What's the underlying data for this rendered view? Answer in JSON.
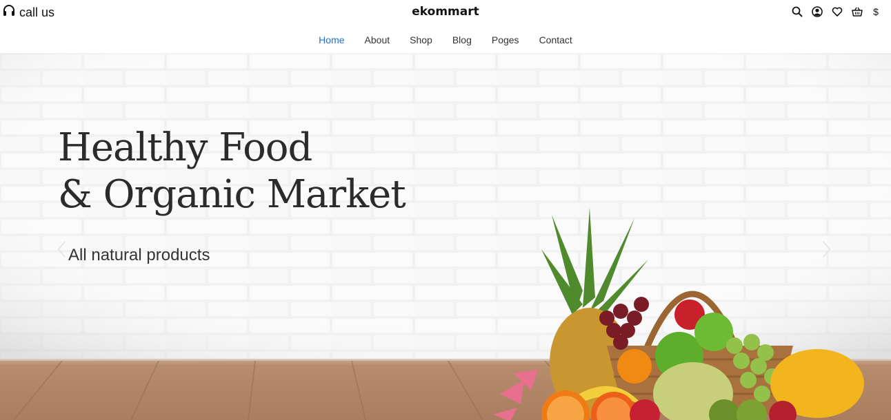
{
  "header": {
    "call_label": "call us",
    "brand": "ekommart",
    "icons": [
      "headset-icon",
      "search-icon",
      "user-icon",
      "heart-icon",
      "basket-icon"
    ],
    "currency_symbol": "$"
  },
  "nav": {
    "items": [
      "Home",
      "About",
      "Shop",
      "Blog",
      "Poges",
      "Contact"
    ],
    "active": "Home",
    "active_color": "#1d6fd1"
  },
  "hero": {
    "title_line1": "Healthy Food",
    "title_line2": "& Organic Market",
    "subtitle": "All natural products"
  }
}
